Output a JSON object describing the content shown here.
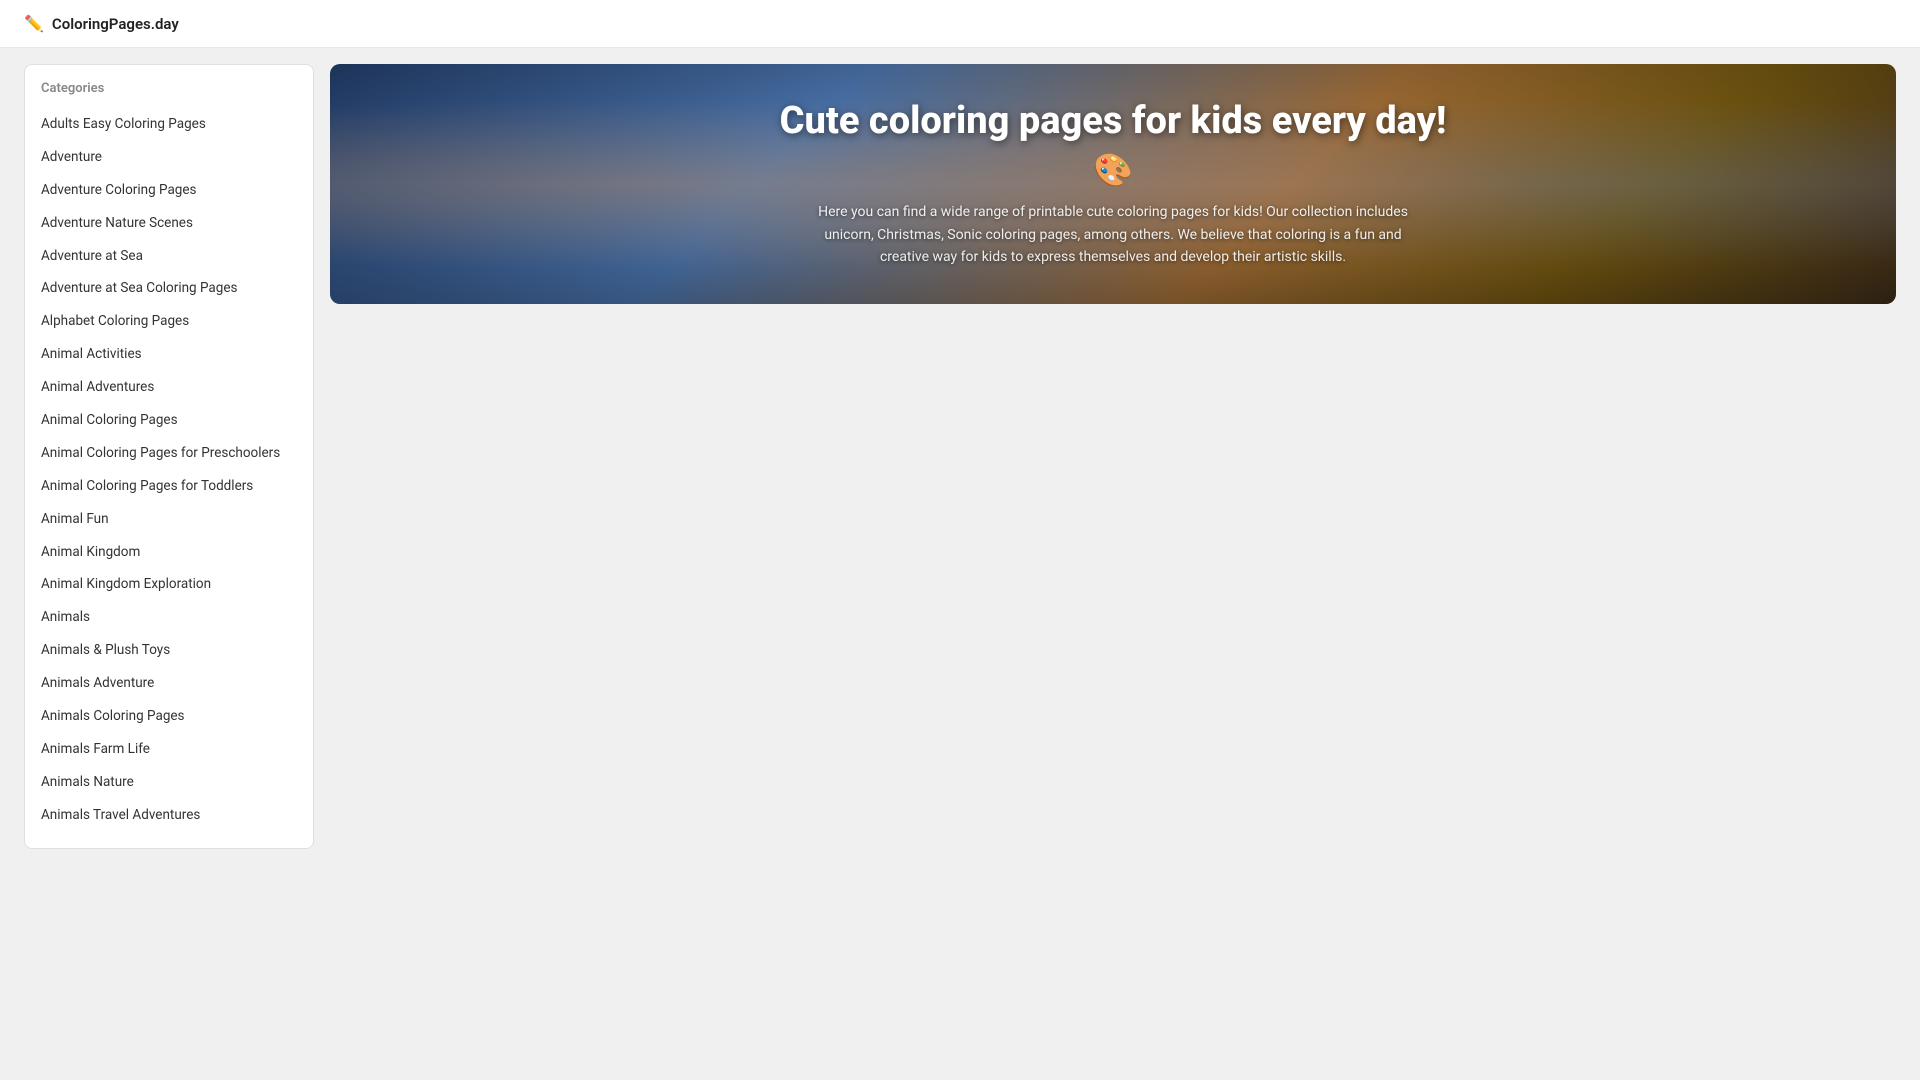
{
  "header": {
    "logo_icon": "✏️",
    "logo_text": "ColoringPages.day"
  },
  "sidebar": {
    "title": "Categories",
    "items": [
      {
        "label": "Adults Easy Coloring Pages"
      },
      {
        "label": "Adventure"
      },
      {
        "label": "Adventure Coloring Pages"
      },
      {
        "label": "Adventure Nature Scenes"
      },
      {
        "label": "Adventure at Sea"
      },
      {
        "label": "Adventure at Sea Coloring Pages"
      },
      {
        "label": "Alphabet Coloring Pages"
      },
      {
        "label": "Animal Activities"
      },
      {
        "label": "Animal Adventures"
      },
      {
        "label": "Animal Coloring Pages"
      },
      {
        "label": "Animal Coloring Pages for Preschoolers"
      },
      {
        "label": "Animal Coloring Pages for Toddlers"
      },
      {
        "label": "Animal Fun"
      },
      {
        "label": "Animal Kingdom"
      },
      {
        "label": "Animal Kingdom Exploration"
      },
      {
        "label": "Animals"
      },
      {
        "label": "Animals & Plush Toys"
      },
      {
        "label": "Animals Adventure"
      },
      {
        "label": "Animals Coloring Pages"
      },
      {
        "label": "Animals Farm Life"
      },
      {
        "label": "Animals Nature"
      },
      {
        "label": "Animals Travel Adventures"
      }
    ]
  },
  "hero": {
    "title": "Cute coloring pages for kids every day!",
    "emoji": "🎨",
    "description": "Here you can find a wide range of printable cute coloring pages for kids! Our collection includes unicorn, Christmas, Sonic coloring pages, among others. We believe that coloring is a fun and creative way for kids to express themselves and develop their artistic skills."
  }
}
